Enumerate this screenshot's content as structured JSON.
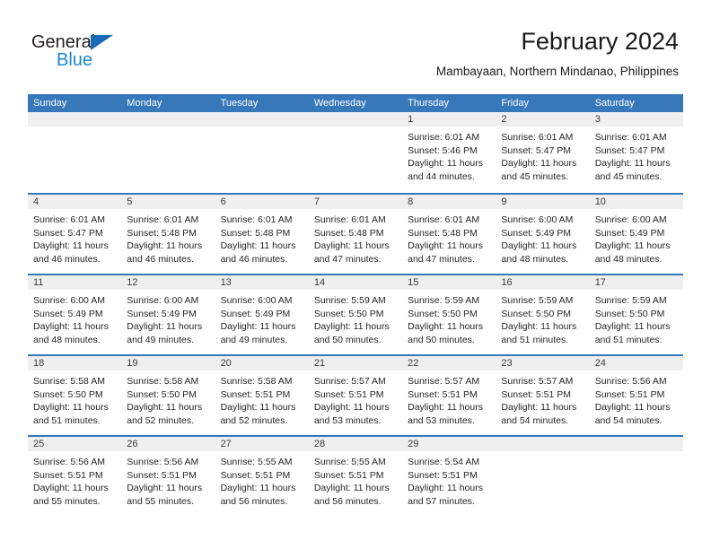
{
  "brand": {
    "name_part1": "General",
    "name_part2": "Blue",
    "triangle_color": "#1a6bb5",
    "blue_color": "#1c86d4"
  },
  "header": {
    "title": "February 2024",
    "subtitle": "Mambayaan, Northern Mindanao, Philippines"
  },
  "theme": {
    "header_row_bg": "#3778bb",
    "day_band_bg": "#efefef",
    "row_separator": "#3778bb",
    "text": "#262626"
  },
  "weekdays": [
    "Sunday",
    "Monday",
    "Tuesday",
    "Wednesday",
    "Thursday",
    "Friday",
    "Saturday"
  ],
  "weeks": [
    [
      {
        "day": ""
      },
      {
        "day": ""
      },
      {
        "day": ""
      },
      {
        "day": ""
      },
      {
        "day": "1",
        "sunrise": "Sunrise: 6:01 AM",
        "sunset": "Sunset: 5:46 PM",
        "daylight1": "Daylight: 11 hours",
        "daylight2": "and 44 minutes."
      },
      {
        "day": "2",
        "sunrise": "Sunrise: 6:01 AM",
        "sunset": "Sunset: 5:47 PM",
        "daylight1": "Daylight: 11 hours",
        "daylight2": "and 45 minutes."
      },
      {
        "day": "3",
        "sunrise": "Sunrise: 6:01 AM",
        "sunset": "Sunset: 5:47 PM",
        "daylight1": "Daylight: 11 hours",
        "daylight2": "and 45 minutes."
      }
    ],
    [
      {
        "day": "4",
        "sunrise": "Sunrise: 6:01 AM",
        "sunset": "Sunset: 5:47 PM",
        "daylight1": "Daylight: 11 hours",
        "daylight2": "and 46 minutes."
      },
      {
        "day": "5",
        "sunrise": "Sunrise: 6:01 AM",
        "sunset": "Sunset: 5:48 PM",
        "daylight1": "Daylight: 11 hours",
        "daylight2": "and 46 minutes."
      },
      {
        "day": "6",
        "sunrise": "Sunrise: 6:01 AM",
        "sunset": "Sunset: 5:48 PM",
        "daylight1": "Daylight: 11 hours",
        "daylight2": "and 46 minutes."
      },
      {
        "day": "7",
        "sunrise": "Sunrise: 6:01 AM",
        "sunset": "Sunset: 5:48 PM",
        "daylight1": "Daylight: 11 hours",
        "daylight2": "and 47 minutes."
      },
      {
        "day": "8",
        "sunrise": "Sunrise: 6:01 AM",
        "sunset": "Sunset: 5:48 PM",
        "daylight1": "Daylight: 11 hours",
        "daylight2": "and 47 minutes."
      },
      {
        "day": "9",
        "sunrise": "Sunrise: 6:00 AM",
        "sunset": "Sunset: 5:49 PM",
        "daylight1": "Daylight: 11 hours",
        "daylight2": "and 48 minutes."
      },
      {
        "day": "10",
        "sunrise": "Sunrise: 6:00 AM",
        "sunset": "Sunset: 5:49 PM",
        "daylight1": "Daylight: 11 hours",
        "daylight2": "and 48 minutes."
      }
    ],
    [
      {
        "day": "11",
        "sunrise": "Sunrise: 6:00 AM",
        "sunset": "Sunset: 5:49 PM",
        "daylight1": "Daylight: 11 hours",
        "daylight2": "and 48 minutes."
      },
      {
        "day": "12",
        "sunrise": "Sunrise: 6:00 AM",
        "sunset": "Sunset: 5:49 PM",
        "daylight1": "Daylight: 11 hours",
        "daylight2": "and 49 minutes."
      },
      {
        "day": "13",
        "sunrise": "Sunrise: 6:00 AM",
        "sunset": "Sunset: 5:49 PM",
        "daylight1": "Daylight: 11 hours",
        "daylight2": "and 49 minutes."
      },
      {
        "day": "14",
        "sunrise": "Sunrise: 5:59 AM",
        "sunset": "Sunset: 5:50 PM",
        "daylight1": "Daylight: 11 hours",
        "daylight2": "and 50 minutes."
      },
      {
        "day": "15",
        "sunrise": "Sunrise: 5:59 AM",
        "sunset": "Sunset: 5:50 PM",
        "daylight1": "Daylight: 11 hours",
        "daylight2": "and 50 minutes."
      },
      {
        "day": "16",
        "sunrise": "Sunrise: 5:59 AM",
        "sunset": "Sunset: 5:50 PM",
        "daylight1": "Daylight: 11 hours",
        "daylight2": "and 51 minutes."
      },
      {
        "day": "17",
        "sunrise": "Sunrise: 5:59 AM",
        "sunset": "Sunset: 5:50 PM",
        "daylight1": "Daylight: 11 hours",
        "daylight2": "and 51 minutes."
      }
    ],
    [
      {
        "day": "18",
        "sunrise": "Sunrise: 5:58 AM",
        "sunset": "Sunset: 5:50 PM",
        "daylight1": "Daylight: 11 hours",
        "daylight2": "and 51 minutes."
      },
      {
        "day": "19",
        "sunrise": "Sunrise: 5:58 AM",
        "sunset": "Sunset: 5:50 PM",
        "daylight1": "Daylight: 11 hours",
        "daylight2": "and 52 minutes."
      },
      {
        "day": "20",
        "sunrise": "Sunrise: 5:58 AM",
        "sunset": "Sunset: 5:51 PM",
        "daylight1": "Daylight: 11 hours",
        "daylight2": "and 52 minutes."
      },
      {
        "day": "21",
        "sunrise": "Sunrise: 5:57 AM",
        "sunset": "Sunset: 5:51 PM",
        "daylight1": "Daylight: 11 hours",
        "daylight2": "and 53 minutes."
      },
      {
        "day": "22",
        "sunrise": "Sunrise: 5:57 AM",
        "sunset": "Sunset: 5:51 PM",
        "daylight1": "Daylight: 11 hours",
        "daylight2": "and 53 minutes."
      },
      {
        "day": "23",
        "sunrise": "Sunrise: 5:57 AM",
        "sunset": "Sunset: 5:51 PM",
        "daylight1": "Daylight: 11 hours",
        "daylight2": "and 54 minutes."
      },
      {
        "day": "24",
        "sunrise": "Sunrise: 5:56 AM",
        "sunset": "Sunset: 5:51 PM",
        "daylight1": "Daylight: 11 hours",
        "daylight2": "and 54 minutes."
      }
    ],
    [
      {
        "day": "25",
        "sunrise": "Sunrise: 5:56 AM",
        "sunset": "Sunset: 5:51 PM",
        "daylight1": "Daylight: 11 hours",
        "daylight2": "and 55 minutes."
      },
      {
        "day": "26",
        "sunrise": "Sunrise: 5:56 AM",
        "sunset": "Sunset: 5:51 PM",
        "daylight1": "Daylight: 11 hours",
        "daylight2": "and 55 minutes."
      },
      {
        "day": "27",
        "sunrise": "Sunrise: 5:55 AM",
        "sunset": "Sunset: 5:51 PM",
        "daylight1": "Daylight: 11 hours",
        "daylight2": "and 56 minutes."
      },
      {
        "day": "28",
        "sunrise": "Sunrise: 5:55 AM",
        "sunset": "Sunset: 5:51 PM",
        "daylight1": "Daylight: 11 hours",
        "daylight2": "and 56 minutes."
      },
      {
        "day": "29",
        "sunrise": "Sunrise: 5:54 AM",
        "sunset": "Sunset: 5:51 PM",
        "daylight1": "Daylight: 11 hours",
        "daylight2": "and 57 minutes."
      },
      {
        "day": ""
      },
      {
        "day": ""
      }
    ]
  ]
}
